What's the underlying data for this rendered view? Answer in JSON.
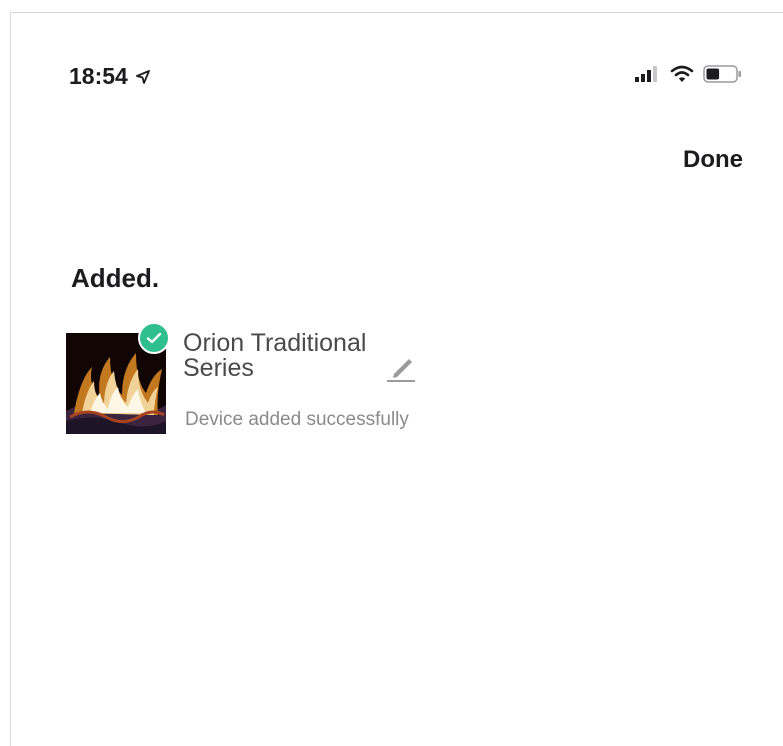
{
  "status_bar": {
    "time": "18:54",
    "location_icon": "location-arrow-icon",
    "signal_icon": "cellular-signal-icon",
    "wifi_icon": "wifi-icon",
    "battery_icon": "battery-icon",
    "battery_level": 0.45
  },
  "header": {
    "done_label": "Done"
  },
  "section": {
    "title": "Added."
  },
  "device": {
    "name": "Orion Traditional Series",
    "status": "Device added successfully",
    "badge_icon": "check-icon",
    "badge_color": "#2fbf8e",
    "edit_icon": "pencil-icon"
  }
}
